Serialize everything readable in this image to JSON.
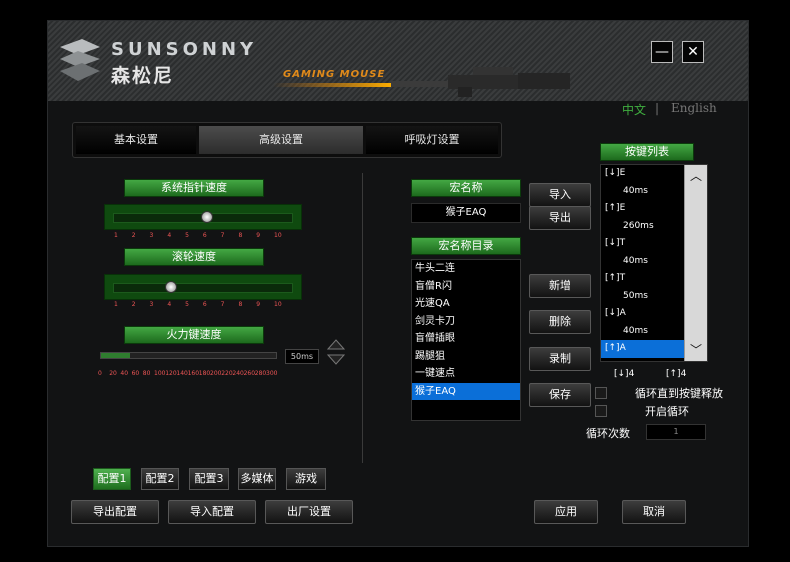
{
  "brand": {
    "name": "SUNSONNY",
    "name_cn": "森松尼",
    "tagline": "GAMING MOUSE"
  },
  "window_controls": {
    "minimize": "—",
    "close": "✕"
  },
  "language": {
    "cn": "中文",
    "separator": "|",
    "en": "English",
    "active_color": "#3fae3f",
    "inactive_color": "#777777"
  },
  "tabs": [
    {
      "label": "基本设置"
    },
    {
      "label": "高级设置",
      "active": true
    },
    {
      "label": "呼吸灯设置"
    }
  ],
  "pointer_speed": {
    "label": "系统指针速度",
    "value": 6,
    "ticks": [
      "1",
      "2",
      "3",
      "4",
      "5",
      "6",
      "7",
      "8",
      "9",
      "10"
    ]
  },
  "scroll_speed": {
    "label": "滚轮速度",
    "value": 4,
    "ticks": [
      "1",
      "2",
      "3",
      "4",
      "5",
      "6",
      "7",
      "8",
      "9",
      "10"
    ]
  },
  "fire_speed": {
    "label": "火力键速度",
    "value_ms": "50ms",
    "ticks": [
      "0",
      "20",
      "40",
      "60",
      "80",
      "100",
      "120",
      "140",
      "160",
      "180",
      "200",
      "220",
      "240",
      "260",
      "280",
      "300"
    ]
  },
  "macro": {
    "name_label": "宏名称",
    "name_value": "猴子EAQ",
    "import": "导入",
    "export": "导出",
    "dir_label": "宏名称目录",
    "items": [
      "牛头二连",
      "盲僧R闪",
      "光速QA",
      "剑灵卡刀",
      "盲僧插眼",
      "踢腿狙",
      "一键速点",
      "猴子EAQ"
    ],
    "selected_index": 7,
    "new": "新增",
    "delete": "删除",
    "record": "录制",
    "save": "保存"
  },
  "key_list": {
    "label": "按键列表",
    "items": [
      {
        "text": "[↓]E",
        "indent": false
      },
      {
        "text": "40ms",
        "indent": true
      },
      {
        "text": "[↑]E",
        "indent": false
      },
      {
        "text": "260ms",
        "indent": true
      },
      {
        "text": "[↓]T",
        "indent": false
      },
      {
        "text": "40ms",
        "indent": true
      },
      {
        "text": "[↑]T",
        "indent": false
      },
      {
        "text": "50ms",
        "indent": true
      },
      {
        "text": "[↓]A",
        "indent": false
      },
      {
        "text": "40ms",
        "indent": true
      },
      {
        "text": "[↑]A",
        "indent": false,
        "selected": true
      }
    ],
    "under_left": "[↓]4",
    "under_right": "[↑]4"
  },
  "loop": {
    "until_release": "循环直到按键释放",
    "enable": "开启循环",
    "count_label": "循环次数",
    "count_value": "1"
  },
  "presets": [
    {
      "label": "配置1",
      "active": true
    },
    {
      "label": "配置2"
    },
    {
      "label": "配置3"
    },
    {
      "label": "多媒体"
    },
    {
      "label": "游戏"
    }
  ],
  "bottom": {
    "export_config": "导出配置",
    "import_config": "导入配置",
    "factory": "出厂设置",
    "apply": "应用",
    "cancel": "取消"
  }
}
